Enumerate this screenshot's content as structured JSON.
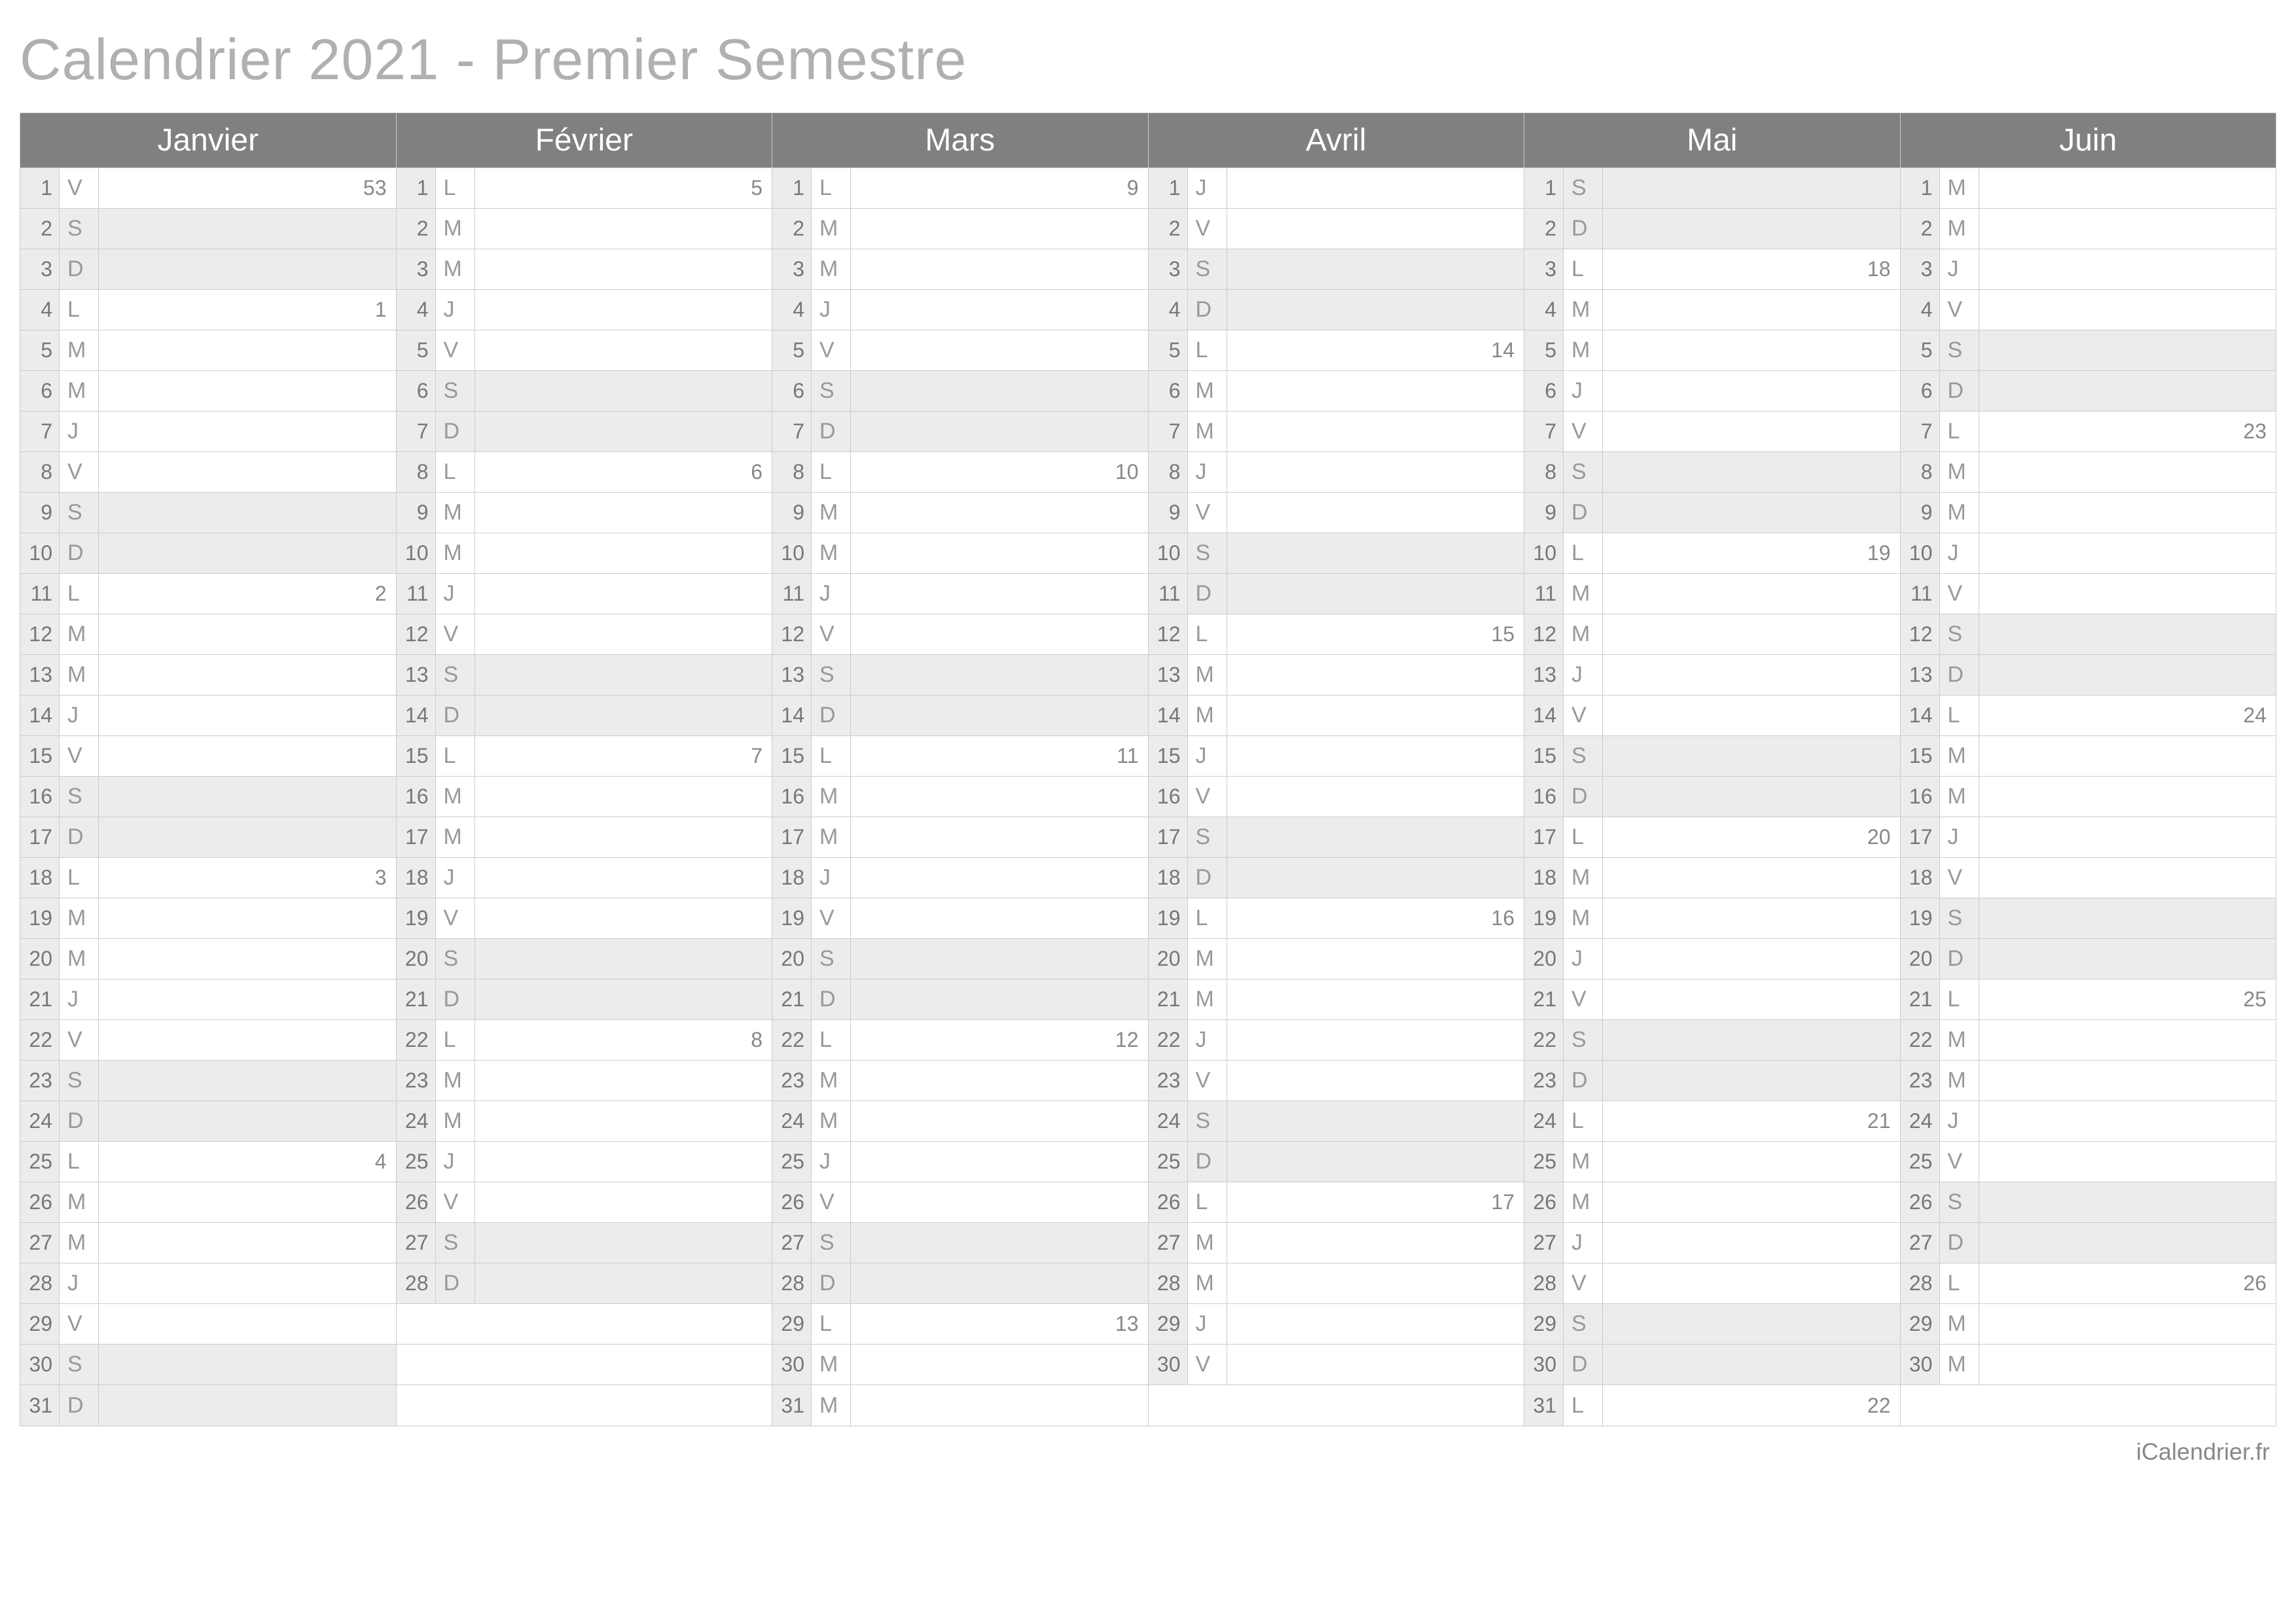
{
  "title": "Calendrier 2021 - Premier Semestre",
  "footer": "iCalendrier.fr",
  "maxDays": 31,
  "months": [
    {
      "name": "Janvier",
      "days": [
        {
          "n": 1,
          "dow": "V",
          "wk": "53"
        },
        {
          "n": 2,
          "dow": "S"
        },
        {
          "n": 3,
          "dow": "D"
        },
        {
          "n": 4,
          "dow": "L",
          "wk": "1"
        },
        {
          "n": 5,
          "dow": "M"
        },
        {
          "n": 6,
          "dow": "M"
        },
        {
          "n": 7,
          "dow": "J"
        },
        {
          "n": 8,
          "dow": "V"
        },
        {
          "n": 9,
          "dow": "S"
        },
        {
          "n": 10,
          "dow": "D"
        },
        {
          "n": 11,
          "dow": "L",
          "wk": "2"
        },
        {
          "n": 12,
          "dow": "M"
        },
        {
          "n": 13,
          "dow": "M"
        },
        {
          "n": 14,
          "dow": "J"
        },
        {
          "n": 15,
          "dow": "V"
        },
        {
          "n": 16,
          "dow": "S"
        },
        {
          "n": 17,
          "dow": "D"
        },
        {
          "n": 18,
          "dow": "L",
          "wk": "3"
        },
        {
          "n": 19,
          "dow": "M"
        },
        {
          "n": 20,
          "dow": "M"
        },
        {
          "n": 21,
          "dow": "J"
        },
        {
          "n": 22,
          "dow": "V"
        },
        {
          "n": 23,
          "dow": "S"
        },
        {
          "n": 24,
          "dow": "D"
        },
        {
          "n": 25,
          "dow": "L",
          "wk": "4"
        },
        {
          "n": 26,
          "dow": "M"
        },
        {
          "n": 27,
          "dow": "M"
        },
        {
          "n": 28,
          "dow": "J"
        },
        {
          "n": 29,
          "dow": "V"
        },
        {
          "n": 30,
          "dow": "S"
        },
        {
          "n": 31,
          "dow": "D"
        }
      ]
    },
    {
      "name": "Février",
      "days": [
        {
          "n": 1,
          "dow": "L",
          "wk": "5"
        },
        {
          "n": 2,
          "dow": "M"
        },
        {
          "n": 3,
          "dow": "M"
        },
        {
          "n": 4,
          "dow": "J"
        },
        {
          "n": 5,
          "dow": "V"
        },
        {
          "n": 6,
          "dow": "S"
        },
        {
          "n": 7,
          "dow": "D"
        },
        {
          "n": 8,
          "dow": "L",
          "wk": "6"
        },
        {
          "n": 9,
          "dow": "M"
        },
        {
          "n": 10,
          "dow": "M"
        },
        {
          "n": 11,
          "dow": "J"
        },
        {
          "n": 12,
          "dow": "V"
        },
        {
          "n": 13,
          "dow": "S"
        },
        {
          "n": 14,
          "dow": "D"
        },
        {
          "n": 15,
          "dow": "L",
          "wk": "7"
        },
        {
          "n": 16,
          "dow": "M"
        },
        {
          "n": 17,
          "dow": "M"
        },
        {
          "n": 18,
          "dow": "J"
        },
        {
          "n": 19,
          "dow": "V"
        },
        {
          "n": 20,
          "dow": "S"
        },
        {
          "n": 21,
          "dow": "D"
        },
        {
          "n": 22,
          "dow": "L",
          "wk": "8"
        },
        {
          "n": 23,
          "dow": "M"
        },
        {
          "n": 24,
          "dow": "M"
        },
        {
          "n": 25,
          "dow": "J"
        },
        {
          "n": 26,
          "dow": "V"
        },
        {
          "n": 27,
          "dow": "S"
        },
        {
          "n": 28,
          "dow": "D"
        }
      ]
    },
    {
      "name": "Mars",
      "days": [
        {
          "n": 1,
          "dow": "L",
          "wk": "9"
        },
        {
          "n": 2,
          "dow": "M"
        },
        {
          "n": 3,
          "dow": "M"
        },
        {
          "n": 4,
          "dow": "J"
        },
        {
          "n": 5,
          "dow": "V"
        },
        {
          "n": 6,
          "dow": "S"
        },
        {
          "n": 7,
          "dow": "D"
        },
        {
          "n": 8,
          "dow": "L",
          "wk": "10"
        },
        {
          "n": 9,
          "dow": "M"
        },
        {
          "n": 10,
          "dow": "M"
        },
        {
          "n": 11,
          "dow": "J"
        },
        {
          "n": 12,
          "dow": "V"
        },
        {
          "n": 13,
          "dow": "S"
        },
        {
          "n": 14,
          "dow": "D"
        },
        {
          "n": 15,
          "dow": "L",
          "wk": "11"
        },
        {
          "n": 16,
          "dow": "M"
        },
        {
          "n": 17,
          "dow": "M"
        },
        {
          "n": 18,
          "dow": "J"
        },
        {
          "n": 19,
          "dow": "V"
        },
        {
          "n": 20,
          "dow": "S"
        },
        {
          "n": 21,
          "dow": "D"
        },
        {
          "n": 22,
          "dow": "L",
          "wk": "12"
        },
        {
          "n": 23,
          "dow": "M"
        },
        {
          "n": 24,
          "dow": "M"
        },
        {
          "n": 25,
          "dow": "J"
        },
        {
          "n": 26,
          "dow": "V"
        },
        {
          "n": 27,
          "dow": "S"
        },
        {
          "n": 28,
          "dow": "D"
        },
        {
          "n": 29,
          "dow": "L",
          "wk": "13"
        },
        {
          "n": 30,
          "dow": "M"
        },
        {
          "n": 31,
          "dow": "M"
        }
      ]
    },
    {
      "name": "Avril",
      "days": [
        {
          "n": 1,
          "dow": "J"
        },
        {
          "n": 2,
          "dow": "V"
        },
        {
          "n": 3,
          "dow": "S"
        },
        {
          "n": 4,
          "dow": "D"
        },
        {
          "n": 5,
          "dow": "L",
          "wk": "14"
        },
        {
          "n": 6,
          "dow": "M"
        },
        {
          "n": 7,
          "dow": "M"
        },
        {
          "n": 8,
          "dow": "J"
        },
        {
          "n": 9,
          "dow": "V"
        },
        {
          "n": 10,
          "dow": "S"
        },
        {
          "n": 11,
          "dow": "D"
        },
        {
          "n": 12,
          "dow": "L",
          "wk": "15"
        },
        {
          "n": 13,
          "dow": "M"
        },
        {
          "n": 14,
          "dow": "M"
        },
        {
          "n": 15,
          "dow": "J"
        },
        {
          "n": 16,
          "dow": "V"
        },
        {
          "n": 17,
          "dow": "S"
        },
        {
          "n": 18,
          "dow": "D"
        },
        {
          "n": 19,
          "dow": "L",
          "wk": "16"
        },
        {
          "n": 20,
          "dow": "M"
        },
        {
          "n": 21,
          "dow": "M"
        },
        {
          "n": 22,
          "dow": "J"
        },
        {
          "n": 23,
          "dow": "V"
        },
        {
          "n": 24,
          "dow": "S"
        },
        {
          "n": 25,
          "dow": "D"
        },
        {
          "n": 26,
          "dow": "L",
          "wk": "17"
        },
        {
          "n": 27,
          "dow": "M"
        },
        {
          "n": 28,
          "dow": "M"
        },
        {
          "n": 29,
          "dow": "J"
        },
        {
          "n": 30,
          "dow": "V"
        }
      ]
    },
    {
      "name": "Mai",
      "days": [
        {
          "n": 1,
          "dow": "S"
        },
        {
          "n": 2,
          "dow": "D"
        },
        {
          "n": 3,
          "dow": "L",
          "wk": "18"
        },
        {
          "n": 4,
          "dow": "M"
        },
        {
          "n": 5,
          "dow": "M"
        },
        {
          "n": 6,
          "dow": "J"
        },
        {
          "n": 7,
          "dow": "V"
        },
        {
          "n": 8,
          "dow": "S"
        },
        {
          "n": 9,
          "dow": "D"
        },
        {
          "n": 10,
          "dow": "L",
          "wk": "19"
        },
        {
          "n": 11,
          "dow": "M"
        },
        {
          "n": 12,
          "dow": "M"
        },
        {
          "n": 13,
          "dow": "J"
        },
        {
          "n": 14,
          "dow": "V"
        },
        {
          "n": 15,
          "dow": "S"
        },
        {
          "n": 16,
          "dow": "D"
        },
        {
          "n": 17,
          "dow": "L",
          "wk": "20"
        },
        {
          "n": 18,
          "dow": "M"
        },
        {
          "n": 19,
          "dow": "M"
        },
        {
          "n": 20,
          "dow": "J"
        },
        {
          "n": 21,
          "dow": "V"
        },
        {
          "n": 22,
          "dow": "S"
        },
        {
          "n": 23,
          "dow": "D"
        },
        {
          "n": 24,
          "dow": "L",
          "wk": "21"
        },
        {
          "n": 25,
          "dow": "M"
        },
        {
          "n": 26,
          "dow": "M"
        },
        {
          "n": 27,
          "dow": "J"
        },
        {
          "n": 28,
          "dow": "V"
        },
        {
          "n": 29,
          "dow": "S"
        },
        {
          "n": 30,
          "dow": "D"
        },
        {
          "n": 31,
          "dow": "L",
          "wk": "22"
        }
      ]
    },
    {
      "name": "Juin",
      "days": [
        {
          "n": 1,
          "dow": "M"
        },
        {
          "n": 2,
          "dow": "M"
        },
        {
          "n": 3,
          "dow": "J"
        },
        {
          "n": 4,
          "dow": "V"
        },
        {
          "n": 5,
          "dow": "S"
        },
        {
          "n": 6,
          "dow": "D"
        },
        {
          "n": 7,
          "dow": "L",
          "wk": "23"
        },
        {
          "n": 8,
          "dow": "M"
        },
        {
          "n": 9,
          "dow": "M"
        },
        {
          "n": 10,
          "dow": "J"
        },
        {
          "n": 11,
          "dow": "V"
        },
        {
          "n": 12,
          "dow": "S"
        },
        {
          "n": 13,
          "dow": "D"
        },
        {
          "n": 14,
          "dow": "L",
          "wk": "24"
        },
        {
          "n": 15,
          "dow": "M"
        },
        {
          "n": 16,
          "dow": "M"
        },
        {
          "n": 17,
          "dow": "J"
        },
        {
          "n": 18,
          "dow": "V"
        },
        {
          "n": 19,
          "dow": "S"
        },
        {
          "n": 20,
          "dow": "D"
        },
        {
          "n": 21,
          "dow": "L",
          "wk": "25"
        },
        {
          "n": 22,
          "dow": "M"
        },
        {
          "n": 23,
          "dow": "M"
        },
        {
          "n": 24,
          "dow": "J"
        },
        {
          "n": 25,
          "dow": "V"
        },
        {
          "n": 26,
          "dow": "S"
        },
        {
          "n": 27,
          "dow": "D"
        },
        {
          "n": 28,
          "dow": "L",
          "wk": "26"
        },
        {
          "n": 29,
          "dow": "M"
        },
        {
          "n": 30,
          "dow": "M"
        }
      ]
    }
  ]
}
